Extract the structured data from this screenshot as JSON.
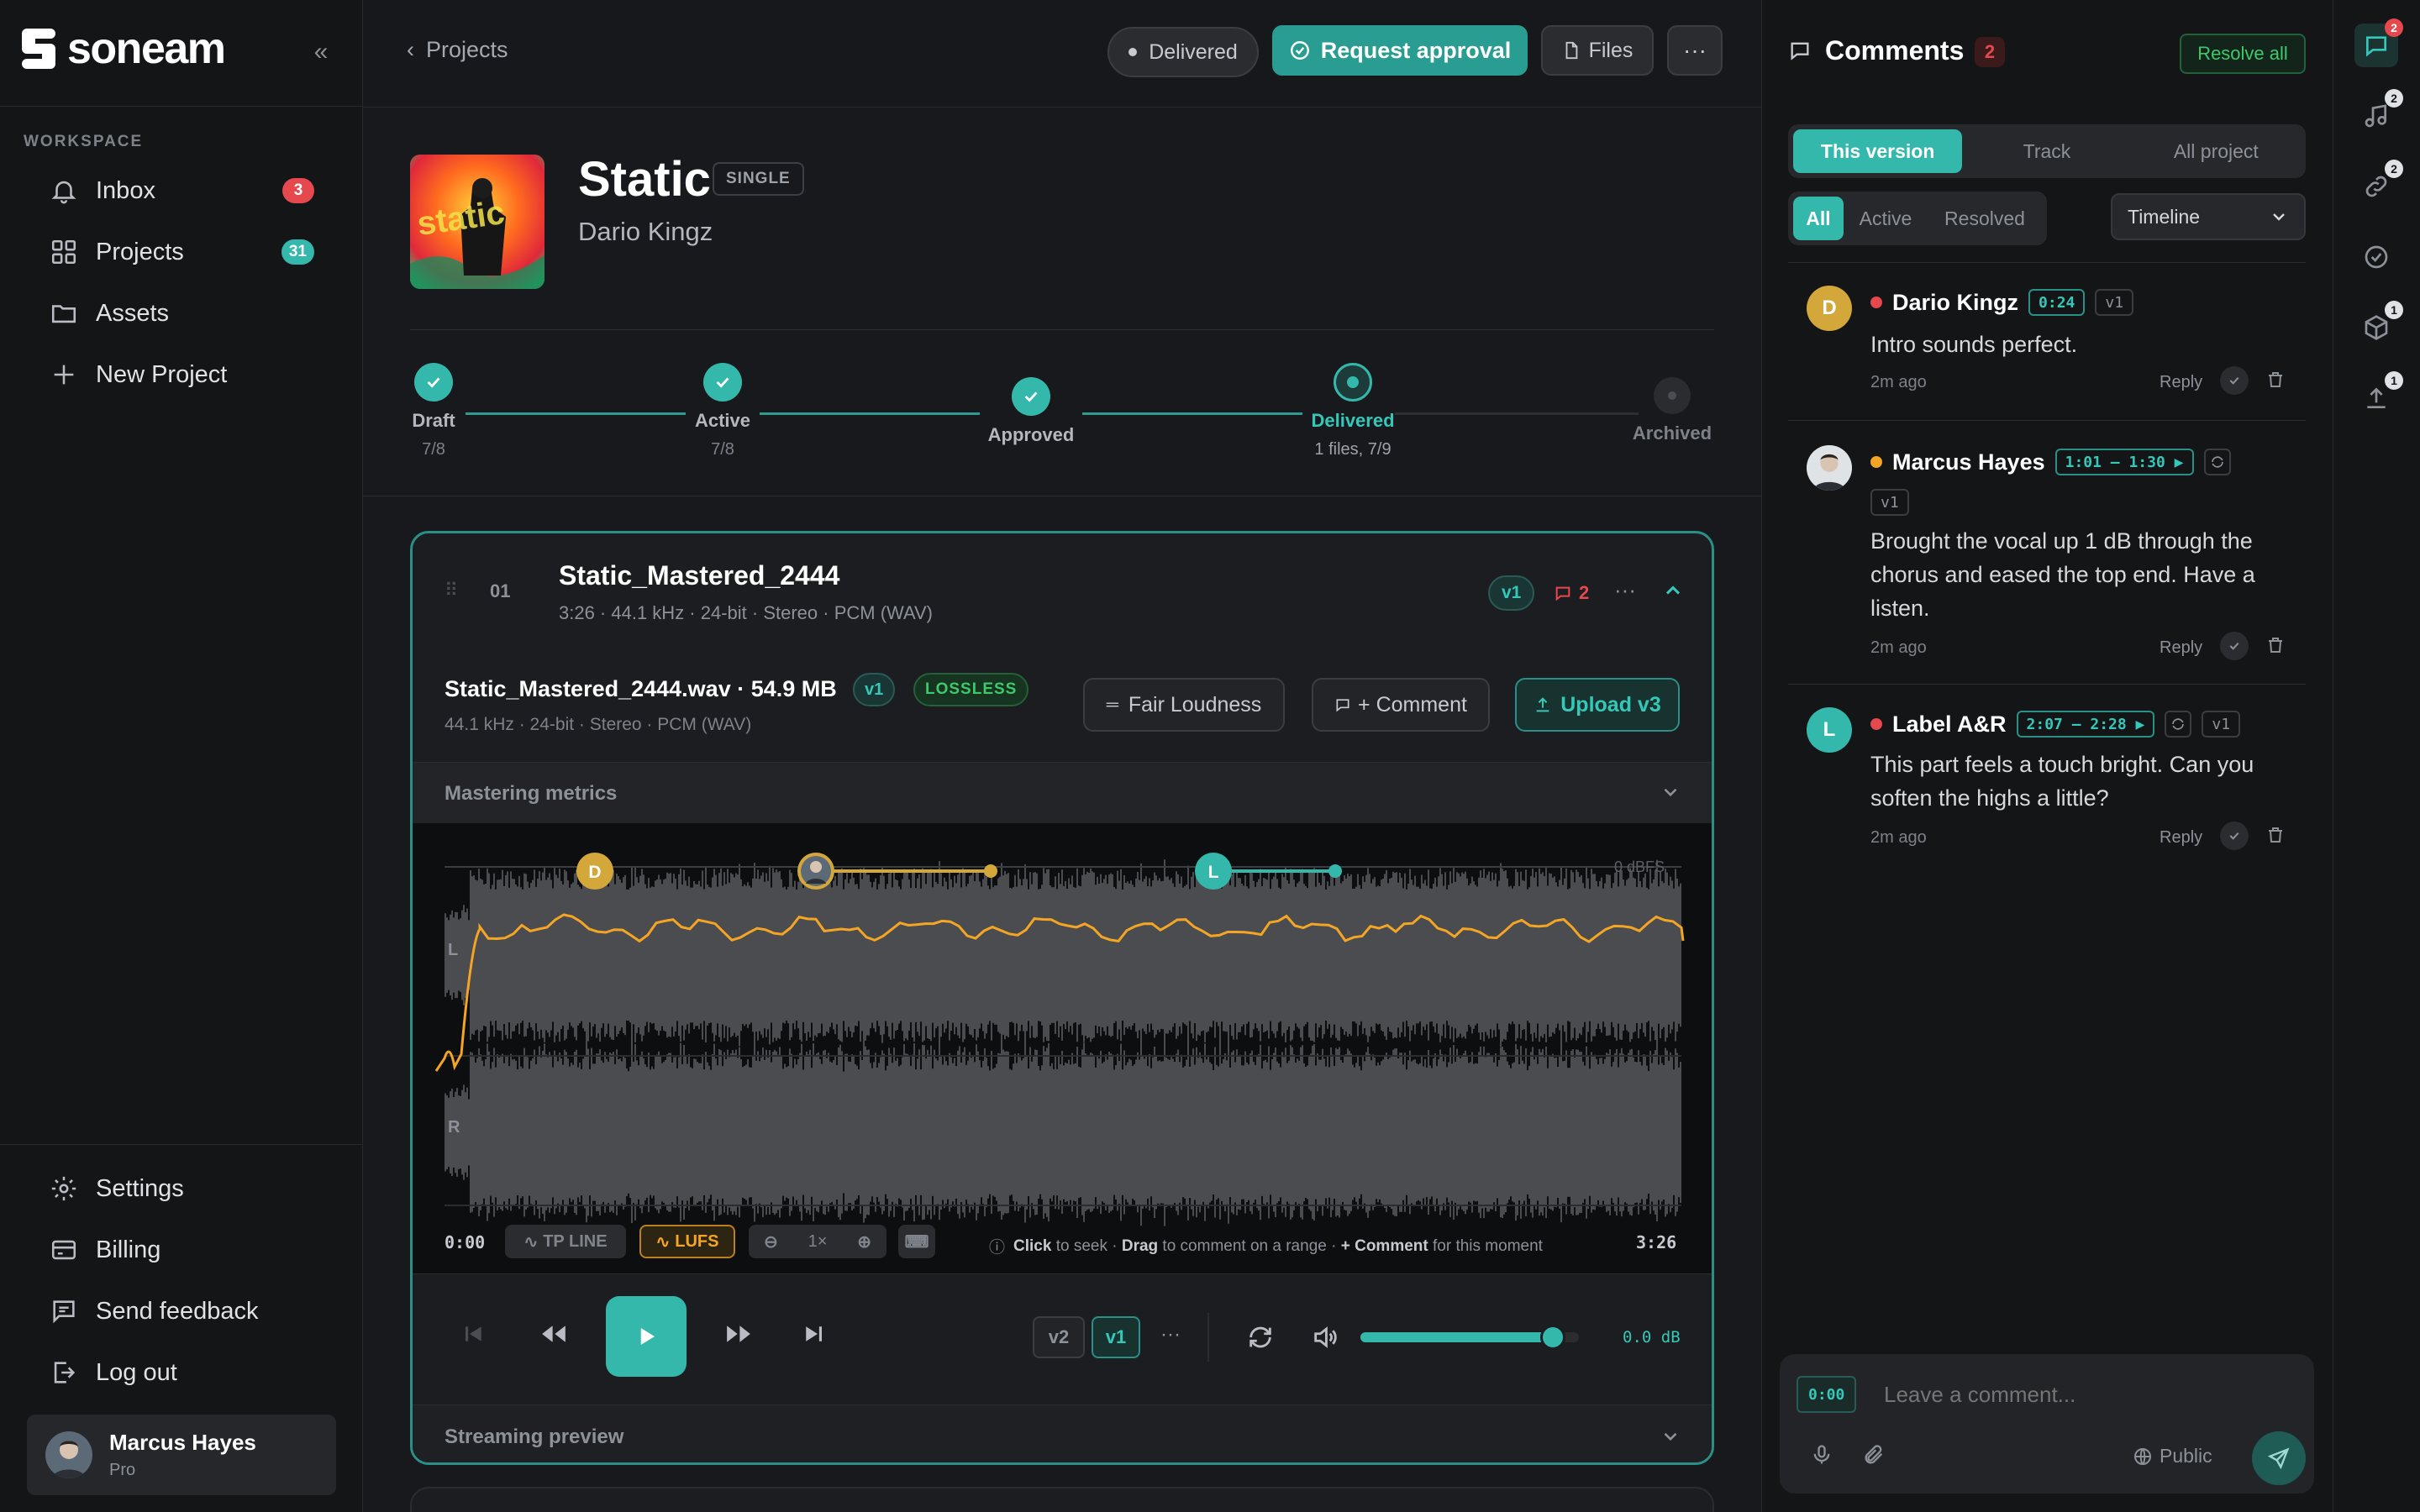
{
  "app": {
    "name": "soneam"
  },
  "sidebar": {
    "section_label": "WORKSPACE",
    "items": [
      {
        "label": "Inbox",
        "badge": "3",
        "icon": "bell-icon"
      },
      {
        "label": "Projects",
        "badge": "31",
        "icon": "grid-icon"
      },
      {
        "label": "Assets",
        "icon": "folder-icon"
      },
      {
        "label": "New Project",
        "icon": "plus-icon"
      }
    ],
    "bottom_items": [
      {
        "label": "Settings",
        "icon": "gear-icon"
      },
      {
        "label": "Billing",
        "icon": "card-icon"
      },
      {
        "label": "Send feedback",
        "icon": "feedback-icon"
      },
      {
        "label": "Log out",
        "icon": "logout-icon"
      }
    ],
    "user": {
      "name": "Marcus Hayes",
      "plan": "Pro"
    }
  },
  "topbar": {
    "breadcrumb": "Projects",
    "status": "Delivered",
    "request_approval": "Request approval",
    "files": "Files"
  },
  "project": {
    "title": "Static",
    "type_badge": "SINGLE",
    "artist": "Dario Kingz",
    "steps": [
      {
        "name": "Draft",
        "sub": "7/8",
        "state": "done"
      },
      {
        "name": "Active",
        "sub": "7/8",
        "state": "done"
      },
      {
        "name": "Approved",
        "sub": "",
        "state": "done"
      },
      {
        "name": "Delivered",
        "sub": "1 files, 7/9",
        "state": "current"
      },
      {
        "name": "Archived",
        "sub": "",
        "state": "pending"
      }
    ]
  },
  "track": {
    "index": "01",
    "name": "Static_Mastered_2444",
    "meta": "3:26 · 44.1 kHz · 24-bit · Stereo · PCM (WAV)",
    "version": "v1",
    "comment_count": "2",
    "file_name": "Static_Mastered_2444.wav · 54.9 MB",
    "file_version": "v1",
    "file_badge": "LOSSLESS",
    "file_meta": "44.1 kHz · 24-bit · Stereo · PCM (WAV)",
    "fair_loudness": "Fair Loudness",
    "comment_btn": "+ Comment",
    "upload": "Upload v3",
    "mastering": "Mastering metrics",
    "dbfs": "0 dBFS",
    "ch_left": "L",
    "ch_right": "R",
    "markers": [
      "D",
      "L"
    ],
    "time_start": "0:00",
    "time_end": "3:26",
    "tp_line": "TP LINE",
    "lufs": "LUFS",
    "zoom": "1×",
    "hint_click": "Click",
    "hint_seek": " to seek · ",
    "hint_drag": "Drag",
    "hint_range": " to comment on a range · ",
    "hint_comment": "+ Comment",
    "hint_moment": " for this moment",
    "versions": [
      "v2",
      "v1"
    ],
    "volume_level": 0.88,
    "db": "0.0 dB",
    "streaming": "Streaming preview"
  },
  "comments": {
    "title": "Comments",
    "count": "2",
    "resolve_all": "Resolve all",
    "scope_tabs": [
      "This version",
      "Track",
      "All project"
    ],
    "filter_tabs": [
      "All",
      "Active",
      "Resolved"
    ],
    "sort": "Timeline",
    "list": [
      {
        "initial": "D",
        "author": "Dario Kingz",
        "time": "0:24",
        "version": "v1",
        "text": "Intro sounds perfect.",
        "ago": "2m ago",
        "reply": "Reply",
        "status_color": "#e5484d"
      },
      {
        "initial": "",
        "author": "Marcus Hayes",
        "time": "1:01 — 1:30 ▶",
        "version": "v1",
        "text": "Brought the vocal up 1 dB through the chorus and eased the top end. Have a listen.",
        "ago": "2m ago",
        "reply": "Reply",
        "status_color": "#f5a524"
      },
      {
        "initial": "L",
        "author": "Label A&R",
        "time": "2:07 — 2:28 ▶",
        "version": "v1",
        "text": "This part feels a touch bright. Can you soften the highs a little?",
        "ago": "2m ago",
        "reply": "Reply",
        "status_color": "#e5484d"
      }
    ],
    "composer": {
      "time": "0:00",
      "placeholder": "Leave a comment...",
      "visibility": "Public"
    }
  },
  "rail": {
    "badges": [
      "2",
      "2",
      "2",
      "",
      "1",
      "1"
    ]
  },
  "colors": {
    "accent": "#35b8ac",
    "red": "#e5484d",
    "amber": "#f5a524",
    "gold": "#d4a73a"
  }
}
